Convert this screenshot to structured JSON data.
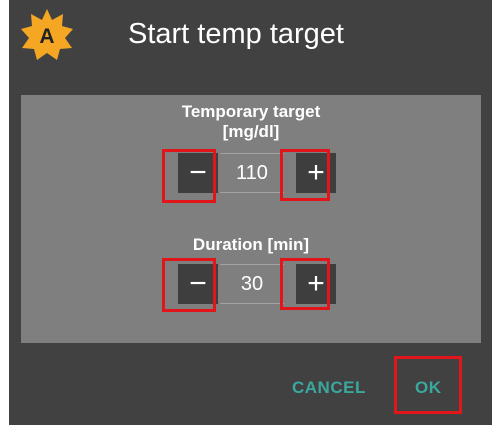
{
  "dialog": {
    "app_icon_letter": "A",
    "title": "Start temp target"
  },
  "target": {
    "label_line1": "Temporary target",
    "label_line2": "[mg/dl]",
    "value": "110",
    "minus_symbol": "−",
    "plus_symbol": "+"
  },
  "duration": {
    "label": "Duration [min]",
    "value": "30",
    "minus_symbol": "−",
    "plus_symbol": "+"
  },
  "actions": {
    "cancel_label": "CANCEL",
    "ok_label": "OK"
  },
  "colors": {
    "dialog_bg": "#414141",
    "panel_bg": "#7f7f7f",
    "button_bg": "#3e3e3e",
    "accent": "#3aa89e",
    "highlight": "#e0161b",
    "icon_orange": "#f5a623"
  }
}
